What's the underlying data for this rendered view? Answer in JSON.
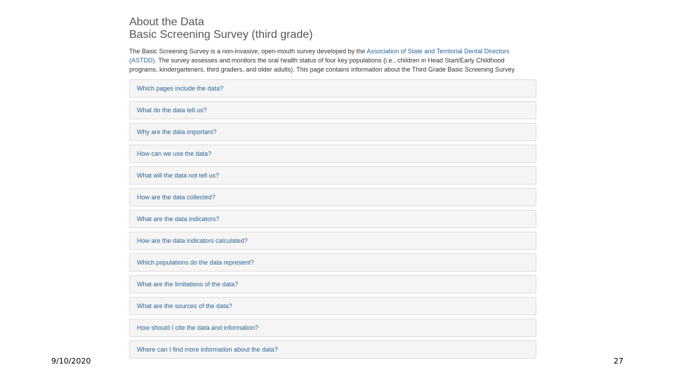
{
  "page": {
    "heading": "About the Data",
    "subheading": "Basic Screening Survey (third grade)",
    "intro": {
      "text_before_link": "The Basic Screening Survey is a non-invasive, open-mouth survey developed by the ",
      "link_text": "Association of State and Territorial Dental Directors (ASTDD)",
      "text_after_link": ". The survey assesses and monitors the oral health status of four key populations (i.e., children in Head Start/Early Childhood programs, kindergarteners, third graders, and older adults). This page contains information about the Third Grade Basic Screening Survey"
    },
    "accordion_items": [
      "Which pages include the data?",
      "What do the data tell us?",
      "Why are the data important?",
      "How can we use the data?",
      "What will the data not tell us?",
      "How are the data collected?",
      "What are the data indicators?",
      "How are the data indicators calculated?",
      "Which populations do the data represent?",
      "What are the limitations of the data?",
      "What are the sources of the data?",
      "How should I cite the data and information?",
      "Where can I find more information about the data?"
    ]
  },
  "slide": {
    "date": "9/10/2020",
    "page_number": "27"
  }
}
